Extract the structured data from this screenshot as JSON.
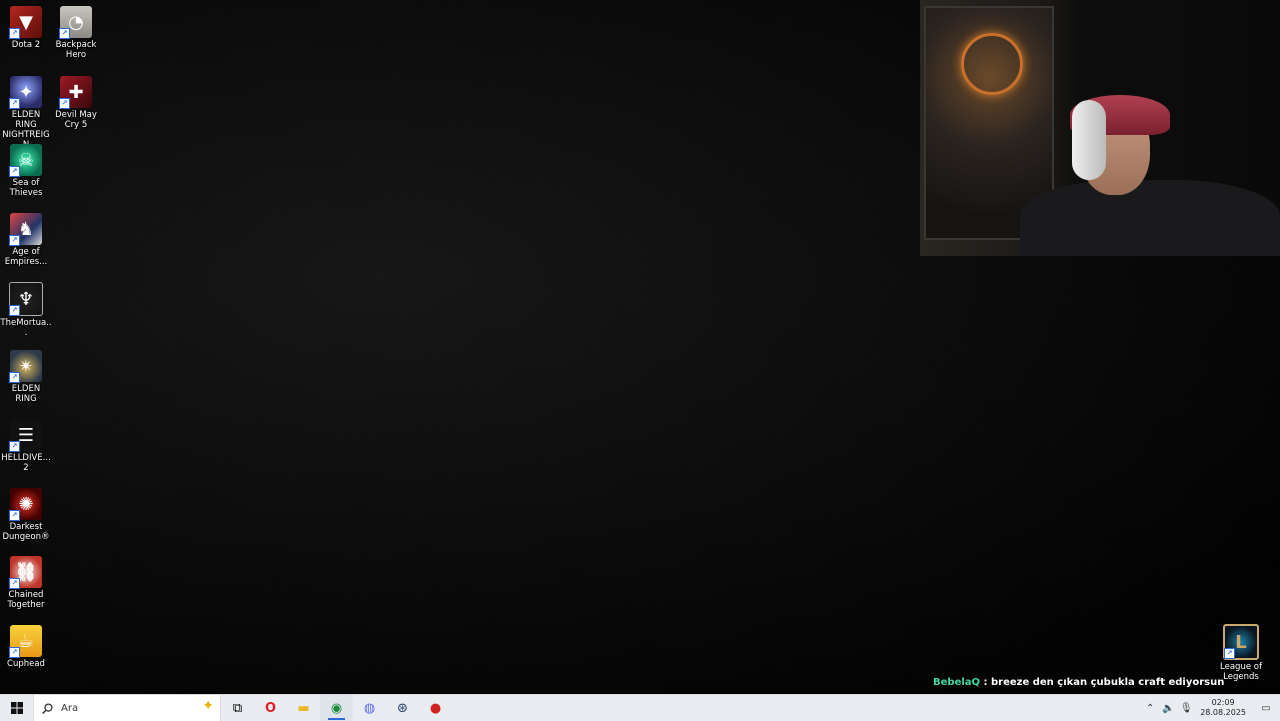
{
  "desktop_icons": [
    {
      "label": "Dota 2",
      "glyph": "▼",
      "icon": "dota2-icon"
    },
    {
      "label": "Backpack Hero",
      "glyph": "◔",
      "icon": "backpack-hero-icon"
    },
    {
      "label": "ELDEN RING NIGHTREIGN",
      "glyph": "✦",
      "icon": "elden-ring-nightreign-icon"
    },
    {
      "label": "Devil May Cry 5",
      "glyph": "✚",
      "icon": "devil-may-cry-icon"
    },
    {
      "label": "Sea of Thieves",
      "glyph": "☠",
      "icon": "sea-of-thieves-icon"
    },
    {
      "label": "Age of Empires...",
      "glyph": "♞",
      "icon": "age-of-empires-icon"
    },
    {
      "label": "TheMortua...",
      "glyph": "♆",
      "icon": "the-mortuary-icon"
    },
    {
      "label": "ELDEN RING",
      "glyph": "✴",
      "icon": "elden-ring-icon"
    },
    {
      "label": "HELLDIVE... 2",
      "glyph": "☰",
      "icon": "helldivers-icon"
    },
    {
      "label": "Darkest Dungeon®",
      "glyph": "✺",
      "icon": "darkest-dungeon-icon"
    },
    {
      "label": "Chained Together",
      "glyph": "⛓",
      "icon": "chained-together-icon"
    },
    {
      "label": "Cuphead",
      "glyph": "☕",
      "icon": "cuphead-icon"
    },
    {
      "label": "League of Legends",
      "glyph": "L",
      "icon": "league-of-legends-icon"
    }
  ],
  "chat": {
    "user": "BebelaQ",
    "separator": " : ",
    "message": "breeze den çıkan çubukla craft ediyorsun"
  },
  "taskbar": {
    "search_placeholder": "Ara",
    "apps": [
      {
        "name": "task-view",
        "glyph": "⧉"
      },
      {
        "name": "opera",
        "glyph": "O"
      },
      {
        "name": "file-explorer",
        "glyph": "▬"
      },
      {
        "name": "chrome",
        "glyph": "◉"
      },
      {
        "name": "discord",
        "glyph": "◍"
      },
      {
        "name": "steam",
        "glyph": "⊛"
      },
      {
        "name": "obs",
        "glyph": "●"
      }
    ],
    "clock_time": "02:09",
    "clock_date": "28.08.2025"
  },
  "colors": {
    "chat_user": "#3fd9a1",
    "taskbar_bg": "#e9ecf1",
    "active_indicator": "#2a6bd9"
  }
}
